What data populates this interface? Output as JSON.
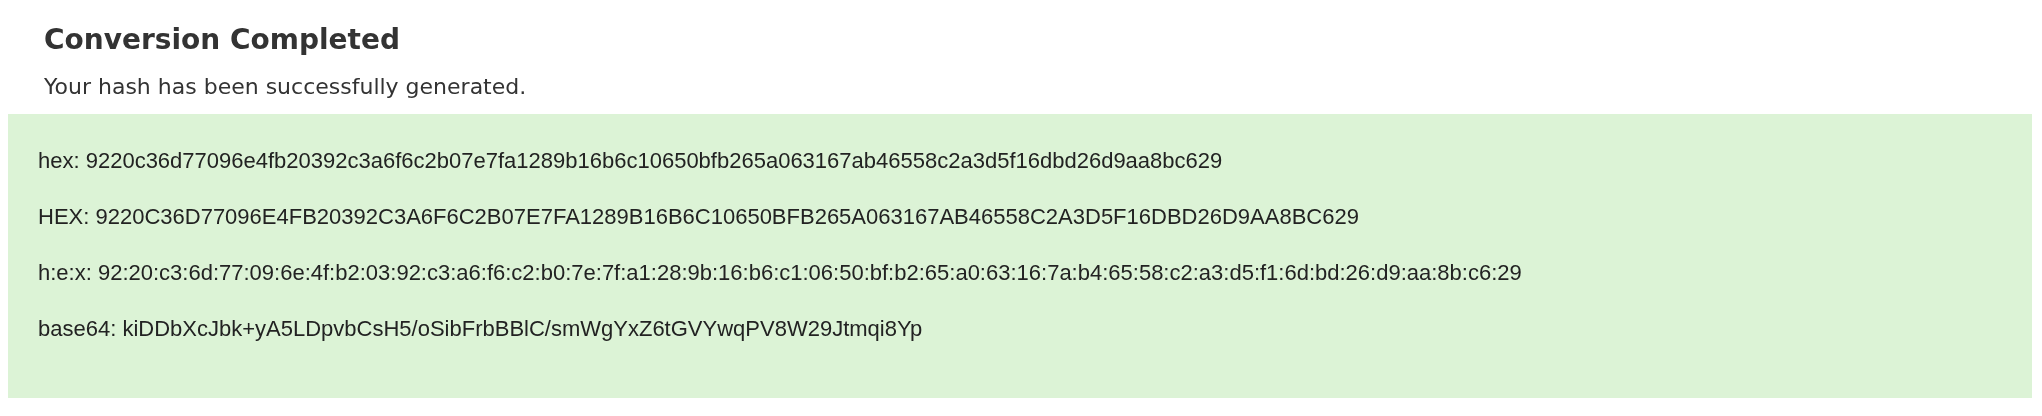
{
  "title": "Conversion Completed",
  "message": "Your hash has been successfully generated.",
  "results": [
    "hex: 9220c36d77096e4fb20392c3a6f6c2b07e7fa1289b16b6c10650bfb265a063167ab46558c2a3d5f16dbd26d9aa8bc629",
    "HEX: 9220C36D77096E4FB20392C3A6F6C2B07E7FA1289B16B6C10650BFB265A063167AB46558C2A3D5F16DBD26D9AA8BC629",
    "h:e:x: 92:20:c3:6d:77:09:6e:4f:b2:03:92:c3:a6:f6:c2:b0:7e:7f:a1:28:9b:16:b6:c1:06:50:bf:b2:65:a0:63:16:7a:b4:65:58:c2:a3:d5:f1:6d:bd:26:d9:aa:8b:c6:29",
    "base64: kiDDbXcJbk+yA5LDpvbCsH5/oSibFrbBBlC/smWgYxZ6tGVYwqPV8W29Jtmqi8Yp"
  ]
}
